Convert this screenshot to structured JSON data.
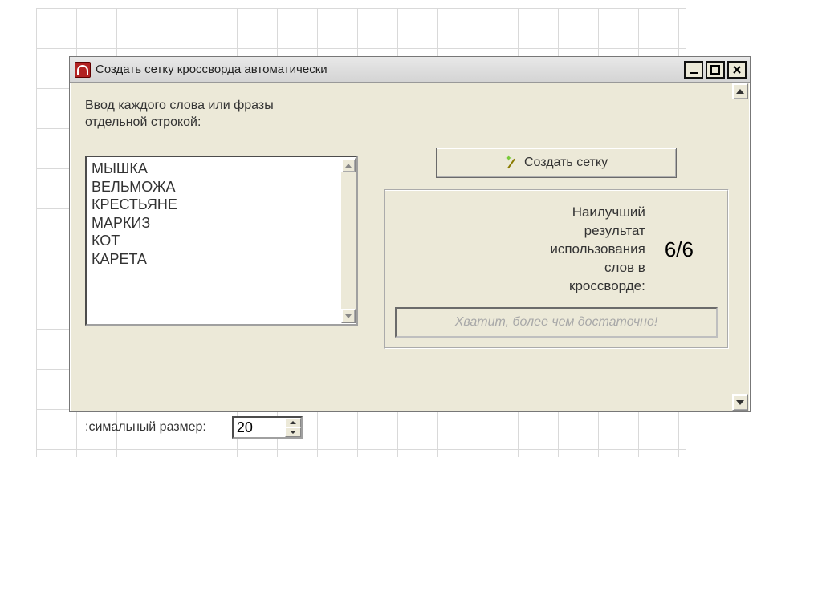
{
  "window": {
    "title": "Создать сетку кроссворда автоматически"
  },
  "main": {
    "intro": "Ввод каждого слова или фразы\nотдельной строкой:",
    "words": [
      "МЫШКА",
      "ВЕЛЬМОЖА",
      "КРЕСТЬЯНЕ",
      "МАРКИЗ",
      "КОТ",
      "КАРЕТА"
    ],
    "words_text": "МЫШКА\nВЕЛЬМОЖА\nКРЕСТЬЯНЕ\nМАРКИЗ\nКОТ\nКАРЕТА",
    "size_label": ":симальный размер:",
    "size_value": "20",
    "create_label": "Создать сетку",
    "result_label": "Наилучший\nрезультат\nиспользования\nслов в\nкроссворде:",
    "result_value": "6/6",
    "enough_label": "Хватит, более чем достаточно!"
  },
  "icons": {
    "app": "java-cup-icon",
    "wand": "magic-wand-icon"
  }
}
